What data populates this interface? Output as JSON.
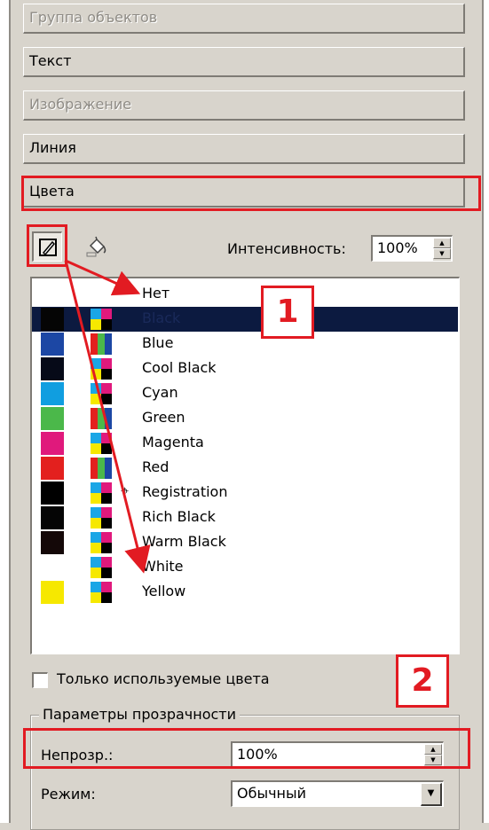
{
  "sections": [
    {
      "label": "Группа объектов",
      "disabled": true
    },
    {
      "label": "Текст",
      "disabled": false
    },
    {
      "label": "Изображение",
      "disabled": true
    },
    {
      "label": "Линия",
      "disabled": false
    },
    {
      "label": "Цвета",
      "disabled": false
    }
  ],
  "toolbar": {
    "stroke_tool_icon": "pencil-icon",
    "fill_tool_icon": "paint-bucket-icon",
    "intensity_label": "Интенсивность:",
    "intensity_value": "100%"
  },
  "colors": [
    {
      "name": "Нет",
      "swatch": null,
      "model": "none"
    },
    {
      "name": "Black",
      "swatch": "#050505",
      "model": "cmyk",
      "selected": true
    },
    {
      "name": "Blue",
      "swatch": "#1c47a4",
      "model": "rgb"
    },
    {
      "name": "Cool Black",
      "swatch": "#060a18",
      "model": "cmyk"
    },
    {
      "name": "Cyan",
      "swatch": "#109ee0",
      "model": "cmyk"
    },
    {
      "name": "Green",
      "swatch": "#4bb84a",
      "model": "rgb"
    },
    {
      "name": "Magenta",
      "swatch": "#e0197c",
      "model": "cmyk"
    },
    {
      "name": "Red",
      "swatch": "#e3201e",
      "model": "rgb"
    },
    {
      "name": "Registration",
      "swatch": "#000000",
      "model": "cmyk",
      "registration": true
    },
    {
      "name": "Rich Black",
      "swatch": "#050505",
      "model": "cmyk"
    },
    {
      "name": "Warm Black",
      "swatch": "#140808",
      "model": "cmyk"
    },
    {
      "name": "White",
      "swatch": "#ffffff",
      "model": "cmyk"
    },
    {
      "name": "Yellow",
      "swatch": "#f6e800",
      "model": "cmyk"
    }
  ],
  "only_used_colors_label": "Только используемые цвета",
  "transparency": {
    "group_title": "Параметры прозрачности",
    "opacity_label": "Непрозр.:",
    "opacity_value": "100%",
    "mode_label": "Режим:",
    "mode_value": "Обычный"
  },
  "annotations": {
    "callout_1": "1",
    "callout_2": "2",
    "highlight_color": "#e21b22"
  }
}
